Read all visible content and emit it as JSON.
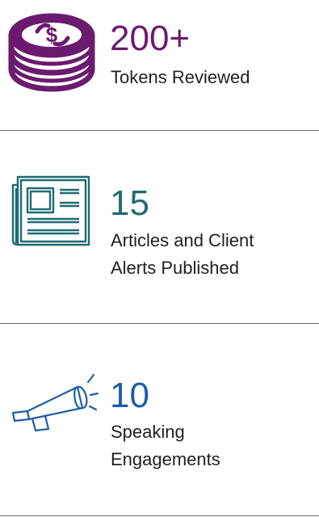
{
  "colors": {
    "tokens": "#6b1a6e",
    "articles": "#1f6b72",
    "speaking": "#1f5ea8",
    "label": "#1f1f1f",
    "divider": "#6b6b6b"
  },
  "stats": [
    {
      "icon": "coin-stack-icon",
      "number": "200+",
      "label_lines": [
        "Tokens Reviewed"
      ]
    },
    {
      "icon": "newspaper-icon",
      "number": "15",
      "label_lines": [
        "Articles and Client",
        "Alerts Published"
      ]
    },
    {
      "icon": "megaphone-icon",
      "number": "10",
      "label_lines": [
        "Speaking",
        "Engagements"
      ]
    }
  ]
}
